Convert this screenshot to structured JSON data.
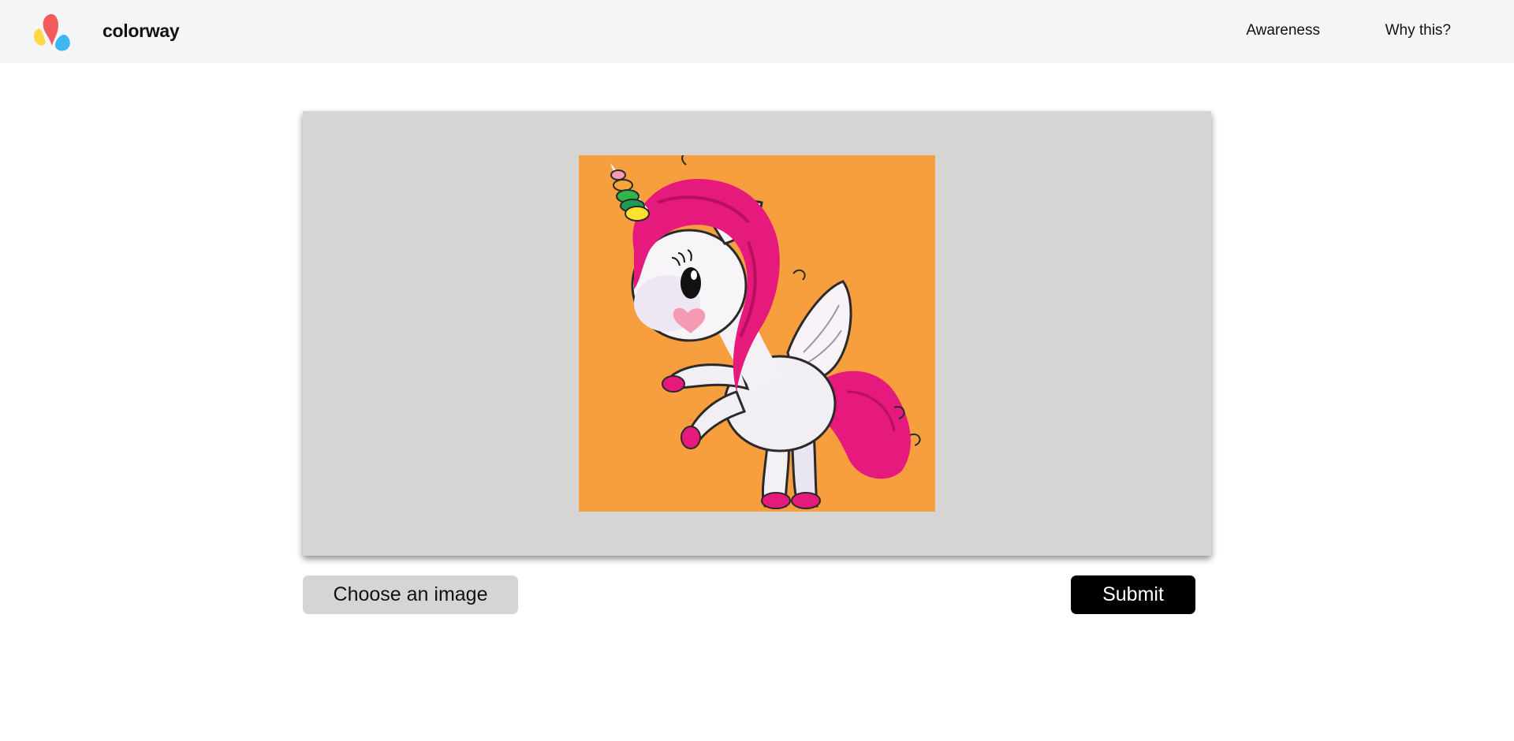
{
  "app": {
    "brand": "colorway",
    "logo_icon": "colorway-logo-icon"
  },
  "nav": {
    "links": [
      {
        "label": "Awareness"
      },
      {
        "label": "Why this?"
      }
    ]
  },
  "preview": {
    "image_icon": "unicorn-illustration",
    "image_background_color": "#f79e3e",
    "panel_color": "#d6d5d4"
  },
  "actions": {
    "choose_label": "Choose an image",
    "submit_label": "Submit"
  },
  "colors": {
    "navbar": "#f5f5f5",
    "submit": "#000000",
    "mane": "#e6197c"
  }
}
